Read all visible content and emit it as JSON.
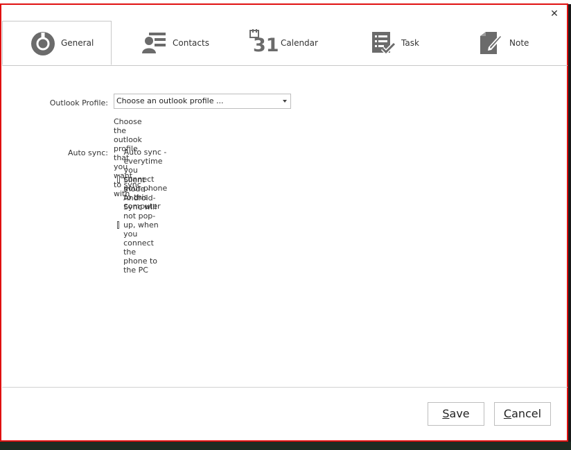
{
  "tabs": {
    "general": "General",
    "contacts": "Contacts",
    "calendar": "Calendar",
    "task": "Task",
    "note": "Note",
    "calendar_icon_day": "31"
  },
  "general": {
    "outlook_profile_label": "Outlook Profile:",
    "outlook_profile_value": "Choose an outlook profile ...",
    "outlook_profile_hint": "Choose the outlook profile that you want to sync with",
    "auto_sync_label": "Auto sync:",
    "auto_sync_option": "Auto sync - everytime you connect your phone to this computer",
    "silent_mode_option": "Silent mode - Android-Sync will not pop-up, when you connect the phone to the PC",
    "auto_sync_checked": false,
    "silent_mode_checked": false
  },
  "buttons": {
    "save_mnemonic": "S",
    "save_rest": "ave",
    "cancel_mnemonic": "C",
    "cancel_rest": "ancel"
  },
  "icons": {
    "close": "close-icon",
    "general": "gear-icon",
    "contacts": "contact-card-icon",
    "calendar": "calendar-icon",
    "task": "task-checklist-icon",
    "note": "note-pencil-icon"
  },
  "colors": {
    "window_border": "#e01010",
    "icon_gray": "#6b6b6b"
  }
}
